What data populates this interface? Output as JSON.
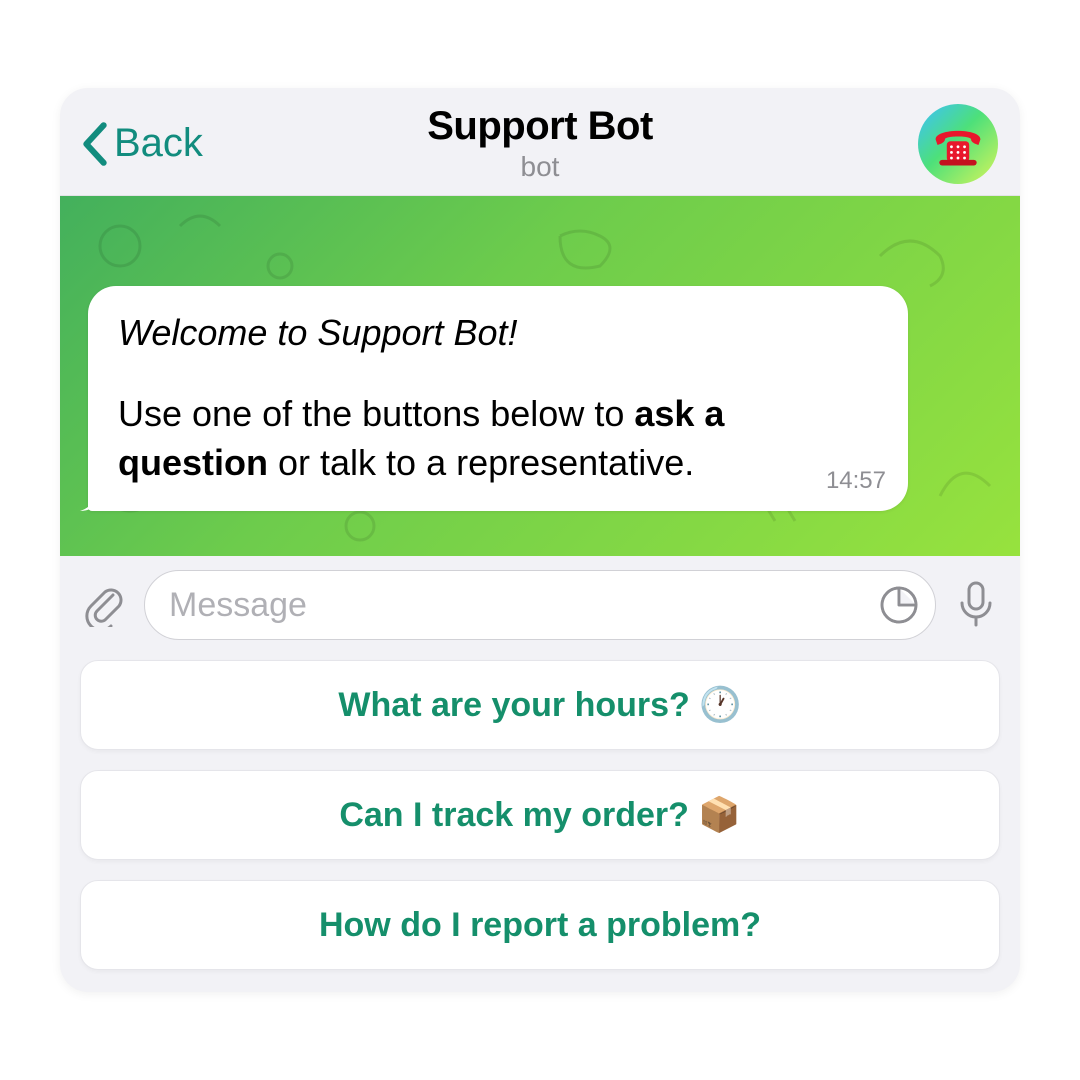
{
  "header": {
    "back_label": "Back",
    "title": "Support Bot",
    "subtitle": "bot"
  },
  "message": {
    "greeting": "Welcome to Support Bot!",
    "body_pre": "Use one of the buttons below to ",
    "body_bold": "ask a question",
    "body_post": " or talk to a representative.",
    "time": "14:57"
  },
  "input": {
    "placeholder": "Message"
  },
  "quick_replies": [
    "What are your hours? 🕐",
    "Can I track my order? 📦",
    "How do I report a problem?"
  ]
}
